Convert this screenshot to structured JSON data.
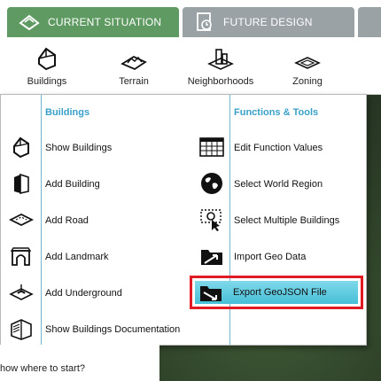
{
  "tabs": {
    "current_label": "CURRENT SITUATION",
    "future_label": "FUTURE DESIGN"
  },
  "ribbon": {
    "items": [
      {
        "label": "Buildings",
        "icon": "buildings-icon"
      },
      {
        "label": "Terrain",
        "icon": "terrain-icon"
      },
      {
        "label": "Neighborhoods",
        "icon": "neighborhoods-icon"
      },
      {
        "label": "Zoning",
        "icon": "zoning-icon"
      }
    ]
  },
  "menu": {
    "left_heading": "Buildings",
    "right_heading": "Functions & Tools",
    "left_items": [
      {
        "label": "Show Buildings",
        "icon": "house-icon"
      },
      {
        "label": "Add Building",
        "icon": "building-icon"
      },
      {
        "label": "Add Road",
        "icon": "road-icon"
      },
      {
        "label": "Add Landmark",
        "icon": "landmark-arch-icon"
      },
      {
        "label": "Add Underground",
        "icon": "underground-icon"
      },
      {
        "label": "Show Buildings Documentation",
        "icon": "book-icon"
      }
    ],
    "right_items": [
      {
        "label": "Edit Function Values",
        "icon": "table-grid-icon"
      },
      {
        "label": "Select World Region",
        "icon": "globe-icon"
      },
      {
        "label": "Select Multiple Buildings",
        "icon": "multi-select-icon"
      },
      {
        "label": "Import Geo Data",
        "icon": "folder-import-icon"
      },
      {
        "label": "Export GeoJSON File",
        "icon": "folder-export-icon"
      }
    ],
    "highlighted": "Export GeoJSON File"
  },
  "footer": {
    "help_text": "how where to start?"
  },
  "colors": {
    "tab_active": "#5f9a62",
    "tab_inactive": "#9aa2a6",
    "heading": "#3aa0c9",
    "highlight_border": "#e01b24",
    "highlight_fill": "#47bfd6"
  }
}
